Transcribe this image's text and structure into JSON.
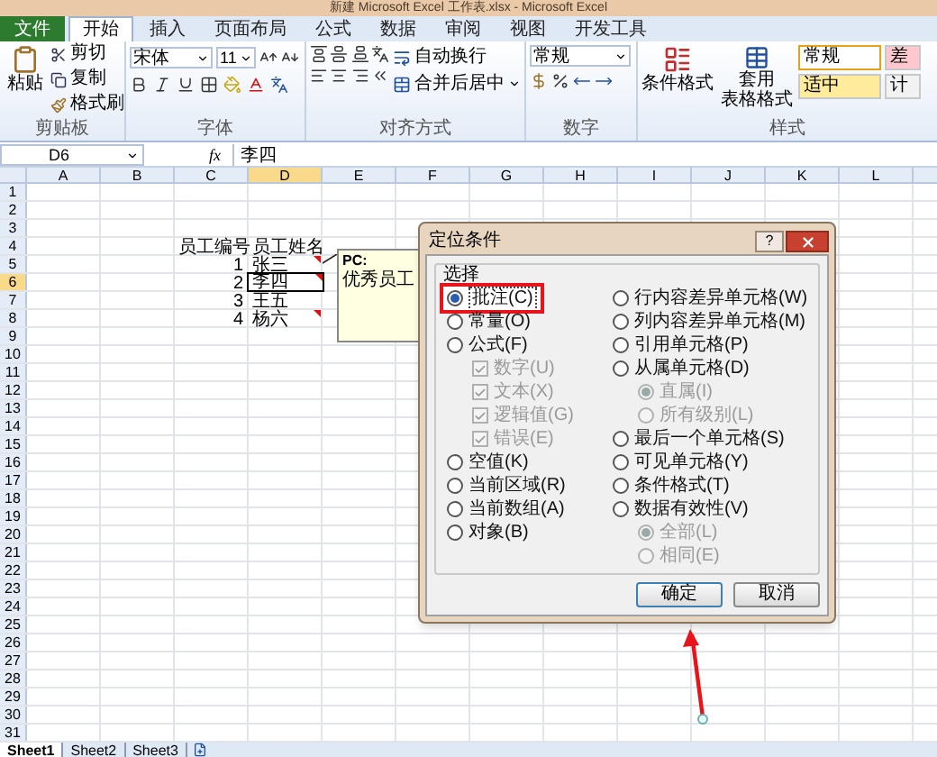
{
  "window": {
    "title": "新建 Microsoft Excel 工作表.xlsx - Microsoft Excel"
  },
  "ribbon_tabs": [
    {
      "label": "文件",
      "kind": "file",
      "selected": false
    },
    {
      "label": "开始",
      "kind": "tab",
      "selected": true
    },
    {
      "label": "插入",
      "kind": "tab",
      "selected": false
    },
    {
      "label": "页面布局",
      "kind": "tab",
      "selected": false
    },
    {
      "label": "公式",
      "kind": "tab",
      "selected": false
    },
    {
      "label": "数据",
      "kind": "tab",
      "selected": false
    },
    {
      "label": "审阅",
      "kind": "tab",
      "selected": false
    },
    {
      "label": "视图",
      "kind": "tab",
      "selected": false
    },
    {
      "label": "开发工具",
      "kind": "tab",
      "selected": false
    }
  ],
  "clipboard": {
    "paste": "粘贴",
    "items": [
      "剪切",
      "复制",
      "格式刷"
    ],
    "label": "剪贴板"
  },
  "font": {
    "font_name": "宋体",
    "font_size": "11",
    "label": "字体"
  },
  "alignment": {
    "wrap": "自动换行",
    "merge": "合并后居中",
    "label": "对齐方式"
  },
  "number": {
    "format": "常规",
    "label": "数字"
  },
  "styles": {
    "conditional": "条件格式",
    "table_format": [
      "套用",
      "表格格式"
    ],
    "label": "样式",
    "cells": [
      {
        "text": "常规",
        "color": "#ffffff",
        "selected": true
      },
      {
        "text": "适中",
        "color": "#ffeb9c",
        "selected": false
      },
      {
        "text": "差",
        "color": "#ffc7ce",
        "selected": false
      },
      {
        "text": "计",
        "color": "#f2f2f2",
        "selected": false
      }
    ]
  },
  "formula_bar": {
    "name_box": "D6",
    "fx": "fx",
    "value": "李四"
  },
  "columns": [
    "A",
    "B",
    "C",
    "D",
    "E",
    "F",
    "G",
    "H",
    "I",
    "J",
    "K",
    "L"
  ],
  "rows": [
    {
      "label": "1"
    },
    {
      "label": "2"
    },
    {
      "label": "3"
    },
    {
      "label": "4",
      "C": {
        "text": "员工编号",
        "selected": false
      },
      "D": {
        "text": "员工姓名",
        "selected": false,
        "has_comment": false
      }
    },
    {
      "label": "5",
      "C": {
        "text": "1",
        "kind": "number",
        "selected": false
      },
      "D": {
        "text": "张三",
        "selected": false,
        "has_comment": true
      }
    },
    {
      "label": "6",
      "C": {
        "text": "2",
        "kind": "number",
        "selected": false
      },
      "D": {
        "text": "李四",
        "selected": true,
        "has_comment": true
      }
    },
    {
      "label": "7",
      "C": {
        "text": "3",
        "kind": "number",
        "selected": false
      },
      "D": {
        "text": "王五",
        "selected": false,
        "has_comment": false
      }
    },
    {
      "label": "8",
      "C": {
        "text": "4",
        "kind": "number",
        "selected": false
      },
      "D": {
        "text": "杨六",
        "selected": false,
        "has_comment": true
      }
    },
    {
      "label": "9"
    },
    {
      "label": "10"
    },
    {
      "label": "11"
    },
    {
      "label": "12"
    },
    {
      "label": "13"
    },
    {
      "label": "14"
    },
    {
      "label": "15"
    },
    {
      "label": "16"
    },
    {
      "label": "17"
    },
    {
      "label": "18"
    },
    {
      "label": "19"
    },
    {
      "label": "20"
    },
    {
      "label": "21"
    },
    {
      "label": "22"
    },
    {
      "label": "23"
    },
    {
      "label": "24"
    },
    {
      "label": "25"
    },
    {
      "label": "26"
    },
    {
      "label": "27"
    },
    {
      "label": "28"
    },
    {
      "label": "29"
    },
    {
      "label": "30"
    },
    {
      "label": "31"
    }
  ],
  "comment": {
    "author": "PC:",
    "text": "优秀员工"
  },
  "dialog": {
    "title": "定位条件",
    "help": "?",
    "group_label": "选择",
    "left_options": [
      {
        "label": "批注(C)",
        "kind": "radio",
        "selected": true,
        "disabled": false,
        "highlighted": true
      },
      {
        "label": "常量(O)",
        "kind": "radio",
        "selected": false,
        "disabled": false,
        "highlighted": false
      },
      {
        "label": "公式(F)",
        "kind": "radio",
        "selected": false,
        "disabled": false,
        "highlighted": false,
        "children": [
          {
            "label": "数字(U)",
            "kind": "checkbox",
            "checked": true,
            "disabled": true,
            "highlighted": false
          },
          {
            "label": "文本(X)",
            "kind": "checkbox",
            "checked": true,
            "disabled": true,
            "highlighted": false
          },
          {
            "label": "逻辑值(G)",
            "kind": "checkbox",
            "checked": true,
            "disabled": true,
            "highlighted": false
          },
          {
            "label": "错误(E)",
            "kind": "checkbox",
            "checked": true,
            "disabled": true,
            "highlighted": false
          }
        ]
      },
      {
        "label": "空值(K)",
        "kind": "radio",
        "selected": false,
        "disabled": false,
        "highlighted": false
      },
      {
        "label": "当前区域(R)",
        "kind": "radio",
        "selected": false,
        "disabled": false,
        "highlighted": false
      },
      {
        "label": "当前数组(A)",
        "kind": "radio",
        "selected": false,
        "disabled": false,
        "highlighted": false
      },
      {
        "label": "对象(B)",
        "kind": "radio",
        "selected": false,
        "disabled": false,
        "highlighted": false
      }
    ],
    "right_options": [
      {
        "label": "行内容差异单元格(W)",
        "kind": "radio",
        "selected": false,
        "disabled": false,
        "highlighted": false
      },
      {
        "label": "列内容差异单元格(M)",
        "kind": "radio",
        "selected": false,
        "disabled": false,
        "highlighted": false
      },
      {
        "label": "引用单元格(P)",
        "kind": "radio",
        "selected": false,
        "disabled": false,
        "highlighted": false
      },
      {
        "label": "从属单元格(D)",
        "kind": "radio",
        "selected": false,
        "disabled": false,
        "highlighted": false,
        "children": [
          {
            "label": "直属(I)",
            "kind": "radio",
            "selected": true,
            "disabled": true,
            "highlighted": false
          },
          {
            "label": "所有级别(L)",
            "kind": "radio",
            "selected": false,
            "disabled": true,
            "highlighted": false
          }
        ]
      },
      {
        "label": "最后一个单元格(S)",
        "kind": "radio",
        "selected": false,
        "disabled": false,
        "highlighted": false
      },
      {
        "label": "可见单元格(Y)",
        "kind": "radio",
        "selected": false,
        "disabled": false,
        "highlighted": false
      },
      {
        "label": "条件格式(T)",
        "kind": "radio",
        "selected": false,
        "disabled": false,
        "highlighted": false
      },
      {
        "label": "数据有效性(V)",
        "kind": "radio",
        "selected": false,
        "disabled": false,
        "highlighted": false,
        "children": [
          {
            "label": "全部(L)",
            "kind": "radio",
            "selected": true,
            "disabled": true,
            "highlighted": false
          },
          {
            "label": "相同(E)",
            "kind": "radio",
            "selected": false,
            "disabled": true,
            "highlighted": false
          }
        ]
      }
    ],
    "buttons": [
      {
        "label": "确定",
        "default": true
      },
      {
        "label": "取消",
        "default": false
      }
    ]
  },
  "sheet_tabs": [
    {
      "label": "Sheet1",
      "selected": true
    },
    {
      "label": "Sheet2",
      "selected": false
    },
    {
      "label": "Sheet3",
      "selected": false
    }
  ]
}
